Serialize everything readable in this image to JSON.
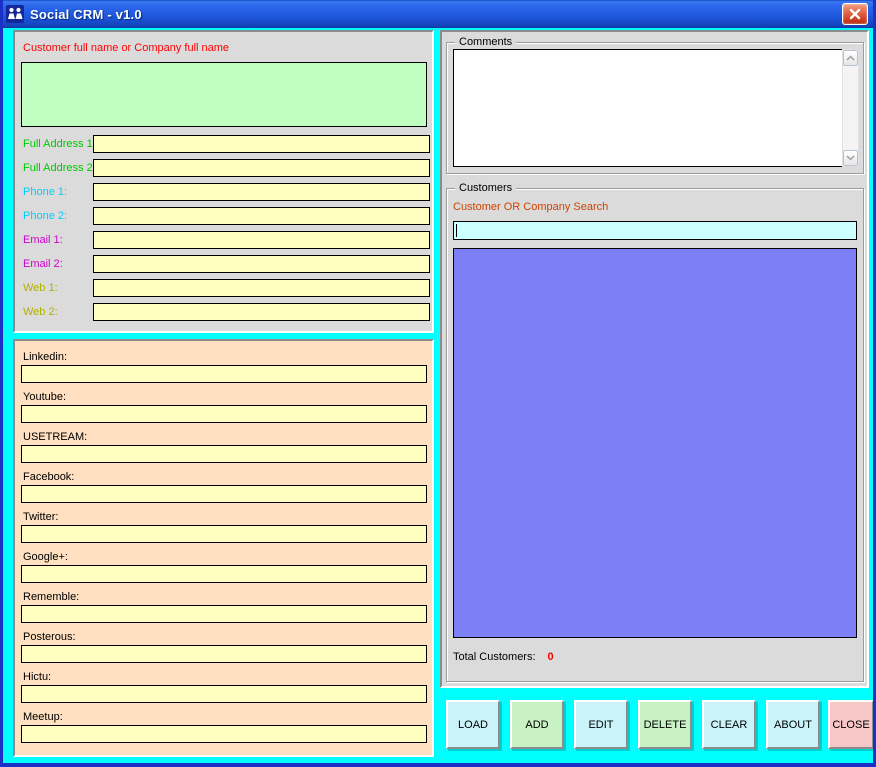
{
  "window": {
    "title": "Social CRM - v1.0"
  },
  "identity_panel": {
    "name_label": "Customer full name or Company full name",
    "name_value": "",
    "fields": [
      {
        "label": "Full Address 1:",
        "value": "",
        "color": "#00C800"
      },
      {
        "label": "Full Address 2:",
        "value": "",
        "color": "#00C800"
      },
      {
        "label": "Phone 1:",
        "value": "",
        "color": "#00CCFF"
      },
      {
        "label": "Phone 2:",
        "value": "",
        "color": "#00CCFF"
      },
      {
        "label": "Email 1:",
        "value": "",
        "color": "#CC00CC"
      },
      {
        "label": "Email 2:",
        "value": "",
        "color": "#CC00CC"
      },
      {
        "label": "Web 1:",
        "value": "",
        "color": "#B0B000"
      },
      {
        "label": "Web 2:",
        "value": "",
        "color": "#B0B000"
      }
    ]
  },
  "social_panel": {
    "fields": [
      {
        "label": "Linkedin:",
        "value": ""
      },
      {
        "label": "Youtube:",
        "value": ""
      },
      {
        "label": "USETREAM:",
        "value": ""
      },
      {
        "label": "Facebook:",
        "value": ""
      },
      {
        "label": "Twitter:",
        "value": ""
      },
      {
        "label": "Google+:",
        "value": ""
      },
      {
        "label": "Rememble:",
        "value": ""
      },
      {
        "label": "Posterous:",
        "value": ""
      },
      {
        "label": "Hictu:",
        "value": ""
      },
      {
        "label": "Meetup:",
        "value": ""
      }
    ]
  },
  "comments": {
    "group_label": "Comments",
    "value": ""
  },
  "customers": {
    "group_label": "Customers",
    "search_label": "Customer OR Company Search",
    "search_value": "",
    "list_items": [],
    "total_label": "Total Customers:",
    "total_value": "0"
  },
  "buttons": [
    {
      "label": "LOAD",
      "color": "#C9F3F9"
    },
    {
      "label": "ADD",
      "color": "#C9F2C4"
    },
    {
      "label": "EDIT",
      "color": "#C9F3F9"
    },
    {
      "label": "DELETE",
      "color": "#C9F2C4"
    },
    {
      "label": "CLEAR",
      "color": "#C9F3F9"
    },
    {
      "label": "ABOUT",
      "color": "#C9F3F9"
    },
    {
      "label": "CLOSE",
      "color": "#F7C6C6"
    }
  ],
  "colors": {
    "titlebar_blue": "#2058DC",
    "frame_cyan": "#00FFFF",
    "frame_border_blue": "#1C30C8",
    "panel_gray": "#DBDBDB",
    "panel_peach": "#FFE0C0",
    "input_yellow": "#FFFFC0",
    "name_area_green": "#C0FFC0",
    "search_cyan": "#CCFFFF",
    "list_purple": "#7D7FF7",
    "close_button_red": "#CC3C1E"
  }
}
